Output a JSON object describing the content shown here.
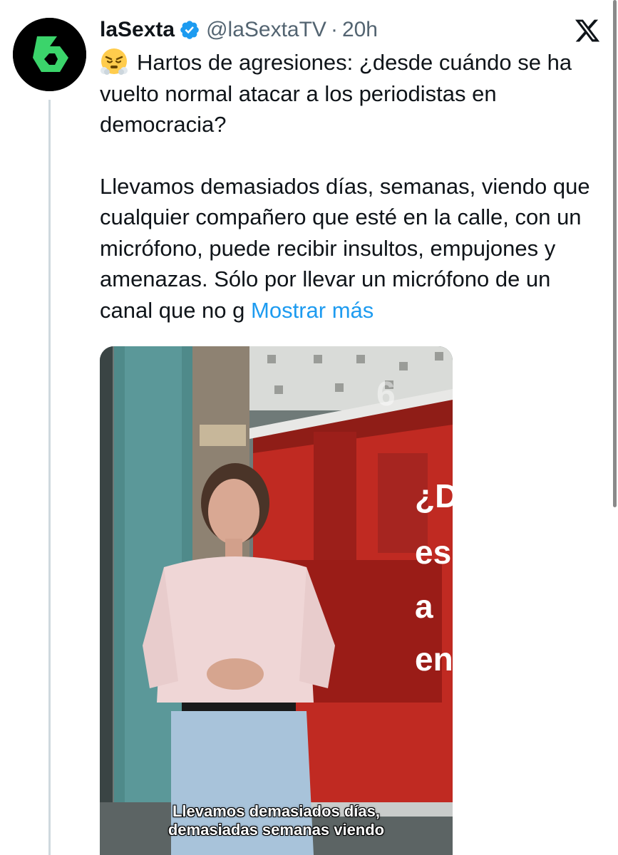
{
  "tweet": {
    "author_name": "laSexta",
    "handle": "@laSextaTV",
    "separator": "·",
    "time": "20h",
    "paragraph1": "Hartos de agresiones: ¿desde cuándo se ha vuelto normal atacar a los periodistas en democracia?",
    "paragraph2": "Llevamos demasiados días, semanas, viendo que cualquier compañero que esté en la calle, con un micrófono, puede recibir insultos, empujones y amenazas. Sólo por llevar un micrófono de un canal que no g",
    "show_more": "Mostrar más"
  },
  "media": {
    "background_text": [
      "¿D",
      "es",
      "a",
      "en"
    ],
    "caption_line1": "Llevamos demasiados días,",
    "caption_line2": "demasiadas semanas viendo",
    "watermark": "6"
  },
  "icons": {
    "avatar": "lasexta-logo",
    "verified": "verified-badge-icon",
    "brand": "x-logo-icon",
    "emoji": "steam-from-nose-emoji"
  },
  "colors": {
    "avatar_bg": "#000000",
    "avatar_logo": "#3bd46b",
    "verified": "#1d9bf0",
    "link": "#1d9bf0",
    "secondary_text": "#536471"
  }
}
